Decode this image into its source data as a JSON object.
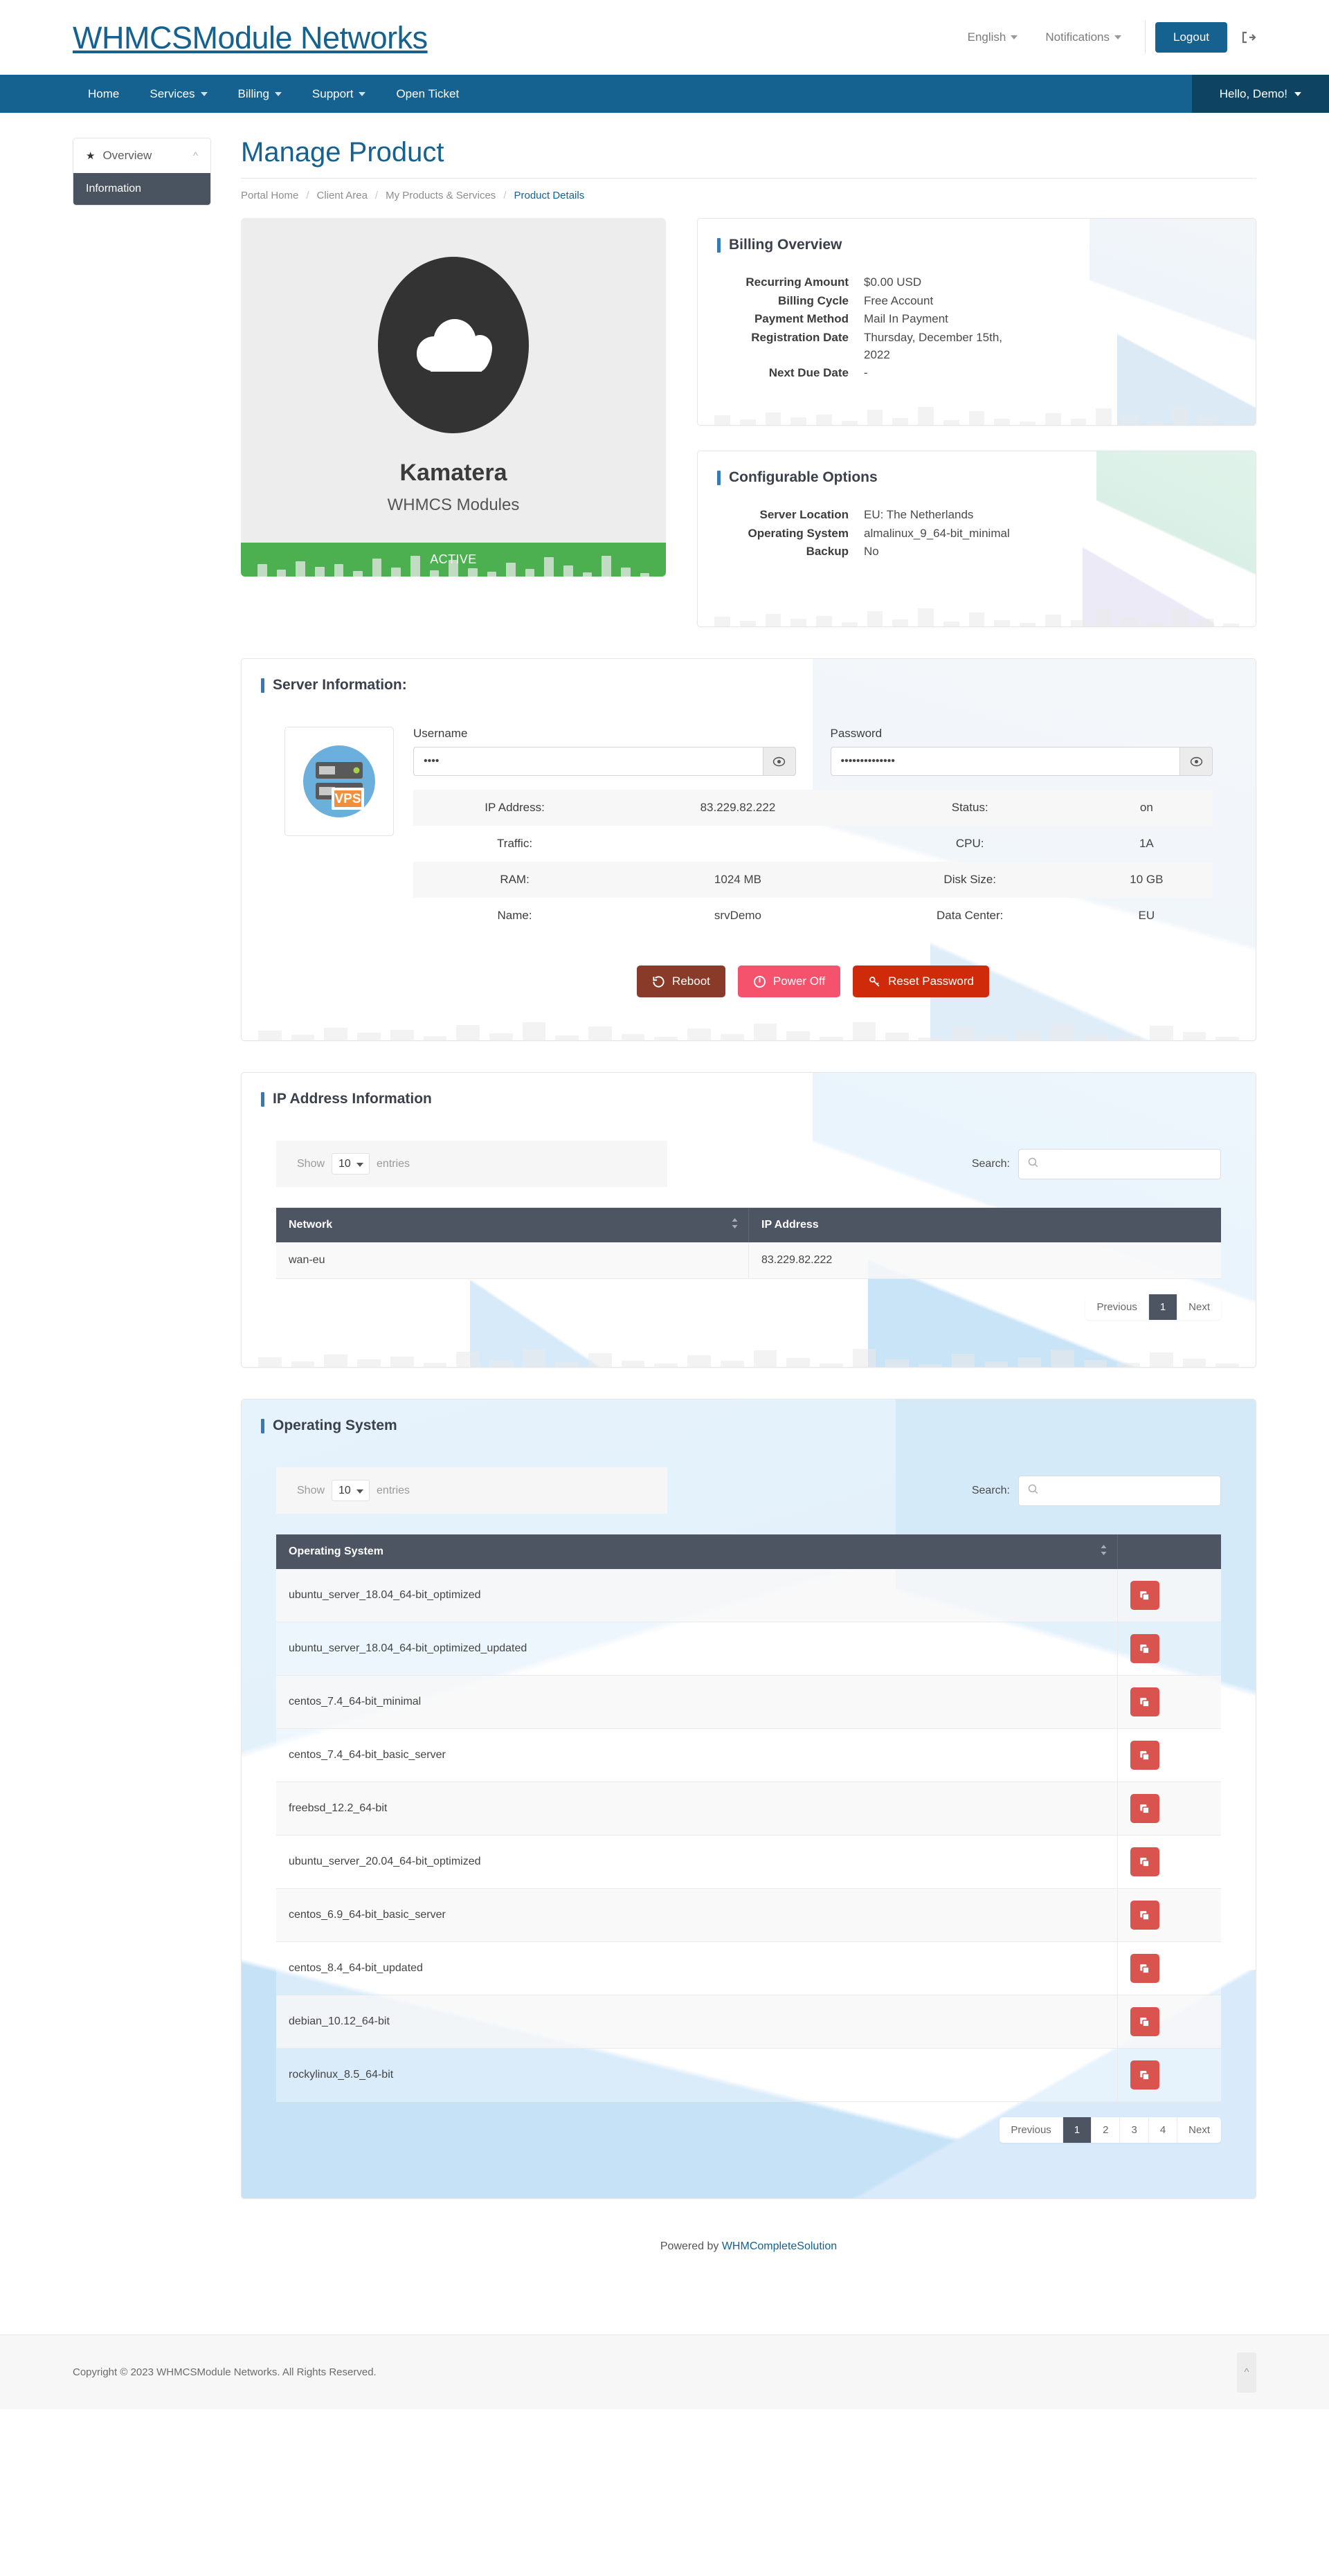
{
  "header": {
    "brand": "WHMCSModule Networks",
    "language": "English",
    "notifications": "Notifications",
    "logout": "Logout"
  },
  "nav": {
    "items": [
      {
        "label": "Home",
        "caret": false
      },
      {
        "label": "Services",
        "caret": true
      },
      {
        "label": "Billing",
        "caret": true
      },
      {
        "label": "Support",
        "caret": true
      },
      {
        "label": "Open Ticket",
        "caret": false
      }
    ],
    "user": "Hello, Demo!"
  },
  "sidebar": {
    "head": "Overview",
    "items": [
      {
        "label": "Information"
      }
    ]
  },
  "page": {
    "title": "Manage Product",
    "breadcrumb": [
      {
        "label": "Portal Home",
        "active": false
      },
      {
        "label": "Client Area",
        "active": false
      },
      {
        "label": "My Products & Services",
        "active": false
      },
      {
        "label": "Product Details",
        "active": true
      }
    ]
  },
  "product": {
    "name": "Kamatera",
    "group": "WHMCS Modules",
    "status": "ACTIVE",
    "status_color": "#4caf50"
  },
  "billing": {
    "title": "Billing Overview",
    "rows": [
      {
        "key": "Recurring Amount",
        "value": "$0.00 USD"
      },
      {
        "key": "Billing Cycle",
        "value": "Free Account"
      },
      {
        "key": "Payment Method",
        "value": "Mail In Payment"
      },
      {
        "key": "Registration Date",
        "value": "Thursday, December 15th, 2022"
      },
      {
        "key": "Next Due Date",
        "value": "-"
      }
    ]
  },
  "configurable": {
    "title": "Configurable Options",
    "rows": [
      {
        "key": "Server Location",
        "value": "EU: The Netherlands"
      },
      {
        "key": "Operating System",
        "value": "almalinux_9_64-bit_minimal"
      },
      {
        "key": "Backup",
        "value": "No"
      }
    ]
  },
  "server_info": {
    "title": "Server Information:",
    "icon_label": "VPS",
    "username_label": "Username",
    "username_value": "••••",
    "password_label": "Password",
    "password_value": "••••••••••••••",
    "rows": [
      {
        "k1": "IP Address:",
        "v1": "83.229.82.222",
        "k2": "Status:",
        "v2": "on"
      },
      {
        "k1": "Traffic:",
        "v1": "",
        "k2": "CPU:",
        "v2": "1A"
      },
      {
        "k1": "RAM:",
        "v1": "1024 MB",
        "k2": "Disk Size:",
        "v2": "10 GB"
      },
      {
        "k1": "Name:",
        "v1": "srvDemo",
        "k2": "Data Center:",
        "v2": "EU"
      }
    ],
    "actions": [
      {
        "label": "Reboot",
        "color": "#8a3a28"
      },
      {
        "label": "Power Off",
        "color": "#f5536d"
      },
      {
        "label": "Reset Password",
        "color": "#cf2b0b"
      }
    ]
  },
  "ip_table": {
    "title": "IP Address Information",
    "show_label": "Show",
    "entries_label": "entries",
    "page_length": "10",
    "search_label": "Search:",
    "search_value": "",
    "columns": [
      "Network",
      "IP Address"
    ],
    "rows": [
      {
        "network": "wan-eu",
        "ip": "83.229.82.222"
      }
    ],
    "pager": {
      "previous": "Previous",
      "pages": [
        "1"
      ],
      "active": "1",
      "next": "Next"
    }
  },
  "os_table": {
    "title": "Operating System",
    "show_label": "Show",
    "entries_label": "entries",
    "page_length": "10",
    "search_label": "Search:",
    "search_value": "",
    "columns": [
      "Operating System",
      ""
    ],
    "rows": [
      {
        "name": "ubuntu_server_18.04_64-bit_optimized"
      },
      {
        "name": "ubuntu_server_18.04_64-bit_optimized_updated"
      },
      {
        "name": "centos_7.4_64-bit_minimal"
      },
      {
        "name": "centos_7.4_64-bit_basic_server"
      },
      {
        "name": "freebsd_12.2_64-bit"
      },
      {
        "name": "ubuntu_server_20.04_64-bit_optimized"
      },
      {
        "name": "centos_6.9_64-bit_basic_server"
      },
      {
        "name": "centos_8.4_64-bit_updated"
      },
      {
        "name": "debian_10.12_64-bit"
      },
      {
        "name": "rockylinux_8.5_64-bit"
      }
    ],
    "pager": {
      "previous": "Previous",
      "pages": [
        "1",
        "2",
        "3",
        "4"
      ],
      "active": "1",
      "next": "Next"
    }
  },
  "footer": {
    "powered_prefix": "Powered by",
    "powered_link": "WHMCompleteSolution",
    "copyright": "Copyright © 2023 WHMCSModule Networks. All Rights Reserved."
  }
}
